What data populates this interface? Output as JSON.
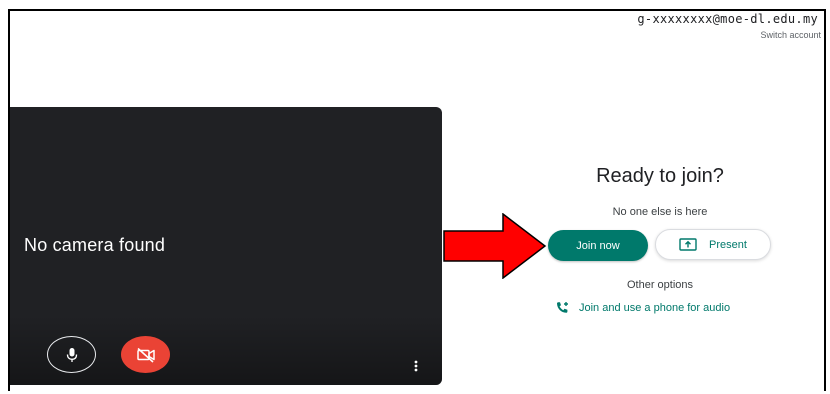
{
  "account": {
    "email": "g-xxxxxxxx@moe-dl.edu.my",
    "switch_label": "Switch account"
  },
  "preview": {
    "status_text": "No camera found",
    "mic_icon": "mic-icon",
    "camera_icon": "camera-off-icon",
    "more_icon": "more-vert-icon"
  },
  "join_panel": {
    "title": "Ready to join?",
    "subtitle": "No one else is here",
    "join_label": "Join now",
    "present_label": "Present",
    "present_icon": "present-screen-icon",
    "other_options_label": "Other options",
    "phone_audio_label": "Join and use a phone for audio",
    "phone_icon": "phone-add-icon"
  },
  "colors": {
    "accent": "#00796b",
    "danger": "#ea4335",
    "video_bg": "#202124",
    "annotation_arrow": "#ff0000"
  }
}
